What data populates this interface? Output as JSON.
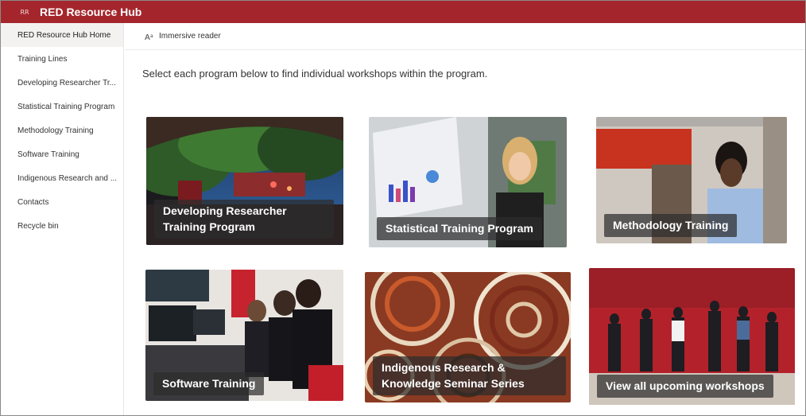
{
  "app": {
    "badge": "RR",
    "title": "RED Resource Hub"
  },
  "sidebar": {
    "items": [
      {
        "label": "RED Resource Hub Home",
        "active": true
      },
      {
        "label": "Training Lines"
      },
      {
        "label": "Developing Researcher Tr..."
      },
      {
        "label": "Statistical Training Program"
      },
      {
        "label": "Methodology Training"
      },
      {
        "label": "Software Training"
      },
      {
        "label": "Indigenous Research and ..."
      },
      {
        "label": "Contacts"
      },
      {
        "label": "Recycle bin"
      }
    ]
  },
  "commandbar": {
    "immersive_reader": "Immersive reader"
  },
  "main": {
    "intro": "Select each program below to find individual workshops within the program.",
    "tiles": [
      {
        "label": "Developing Researcher Training Program"
      },
      {
        "label": "Statistical Training Program"
      },
      {
        "label": "Methodology Training"
      },
      {
        "label": "Software Training"
      },
      {
        "label": "Indigenous Research & Knowledge Seminar Series"
      },
      {
        "label": "View all upcoming workshops"
      }
    ]
  },
  "colors": {
    "brand": "#a4262c"
  }
}
